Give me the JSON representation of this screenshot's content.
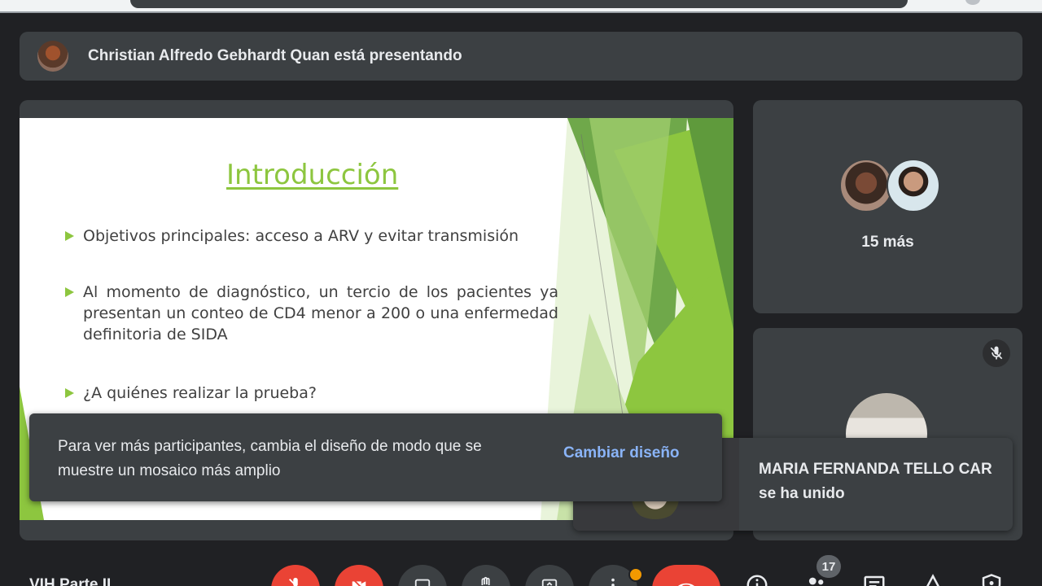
{
  "presenter_banner": {
    "text": "Christian Alfredo Gebhardt Quan está presentando"
  },
  "slide": {
    "title": "Introducción",
    "bullets": [
      "Objetivos principales: acceso a ARV y evitar transmisión",
      "Al momento de diagnóstico, un tercio de los pacientes ya presentan un conteo de CD4 menor a 200 o una enfermedad definitoria de SIDA",
      "¿A quiénes realizar la prueba?"
    ],
    "accent_color": "#8dc63f"
  },
  "participants_tile": {
    "more_label": "15 más"
  },
  "snackbar": {
    "message": "Para ver más participantes, cambia el diseño de modo que se muestre un mosaico más amplio",
    "action": "Cambiar diseño"
  },
  "join_toast": {
    "text": "MARIA FERNANDA TELLO CAR se ha unido"
  },
  "meeting": {
    "name": "VIH Parte II"
  },
  "controls": {
    "participant_count": "17"
  },
  "icons": {
    "mic_off": "mic-off-icon",
    "cam_off": "camera-off-icon",
    "captions": "captions-icon",
    "hand": "raise-hand-icon",
    "present": "present-icon",
    "more": "more-vert-icon",
    "end": "call-end-icon",
    "info": "info-icon",
    "people": "people-icon",
    "chat": "chat-icon",
    "activities": "activities-icon",
    "lock": "host-controls-icon"
  }
}
